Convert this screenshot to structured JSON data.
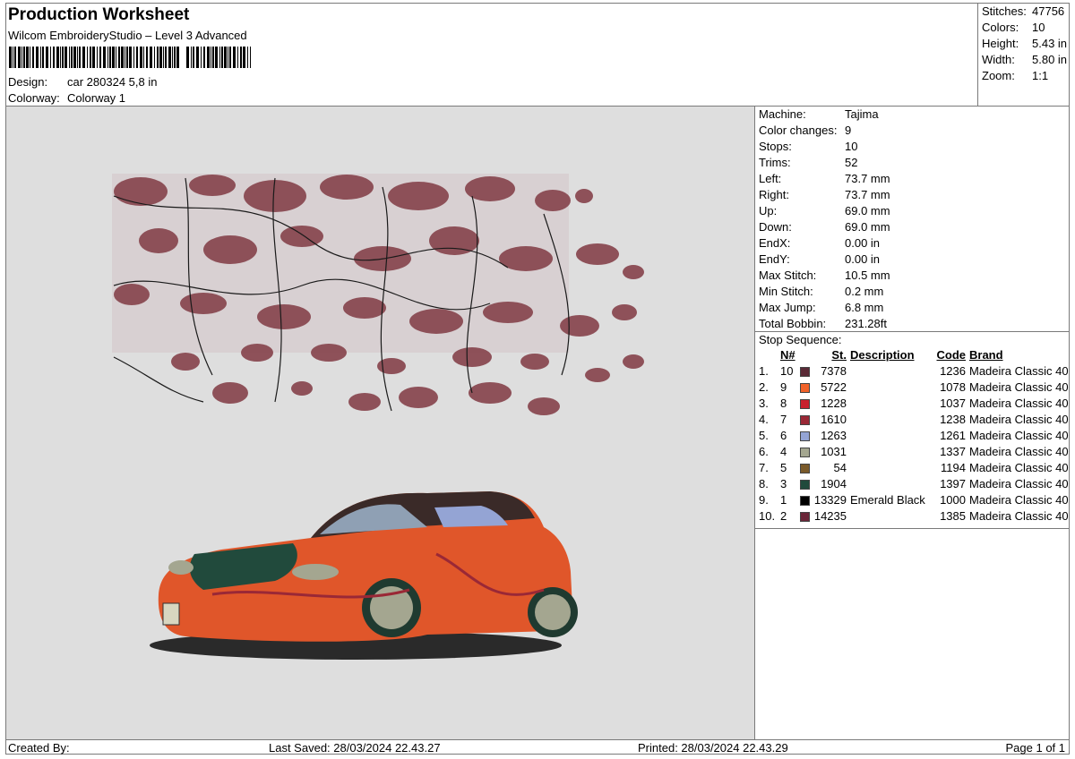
{
  "header": {
    "title": "Production Worksheet",
    "subtitle": "Wilcom EmbroideryStudio – Level 3 Advanced",
    "design_label": "Design:",
    "design_value": "car 280324 5,8 in",
    "colorway_label": "Colorway:",
    "colorway_value": "Colorway 1"
  },
  "summary": [
    {
      "label": "Stitches:",
      "value": "47756"
    },
    {
      "label": "Colors:",
      "value": "10"
    },
    {
      "label": "Height:",
      "value": "5.43 in"
    },
    {
      "label": "Width:",
      "value": "5.80 in"
    },
    {
      "label": "Zoom:",
      "value": "1:1"
    }
  ],
  "machine_info": [
    {
      "label": "Machine:",
      "value": "Tajima"
    },
    {
      "label": "Color changes:",
      "value": "9"
    },
    {
      "label": "Stops:",
      "value": "10"
    },
    {
      "label": "Trims:",
      "value": "52"
    },
    {
      "label": "Left:",
      "value": "73.7 mm"
    },
    {
      "label": "Right:",
      "value": "73.7 mm"
    },
    {
      "label": "Up:",
      "value": "69.0 mm"
    },
    {
      "label": "Down:",
      "value": "69.0 mm"
    },
    {
      "label": "EndX:",
      "value": "0.00 in"
    },
    {
      "label": "EndY:",
      "value": "0.00 in"
    },
    {
      "label": "Max Stitch:",
      "value": "10.5 mm"
    },
    {
      "label": "Min Stitch:",
      "value": "0.2 mm"
    },
    {
      "label": "Max Jump:",
      "value": "6.8 mm"
    },
    {
      "label": "Total Bobbin:",
      "value": "231.28ft"
    }
  ],
  "stop_sequence": {
    "title": "Stop Sequence:",
    "columns": {
      "n": "N#",
      "st": "St.",
      "desc": "Description",
      "code": "Code",
      "brand": "Brand"
    },
    "rows": [
      {
        "idx": "1.",
        "n": "10",
        "color": "#5a2a36",
        "st": "7378",
        "desc": "",
        "code": "1236",
        "brand": "Madeira Classic 40"
      },
      {
        "idx": "2.",
        "n": "9",
        "color": "#f0622a",
        "st": "5722",
        "desc": "",
        "code": "1078",
        "brand": "Madeira Classic 40"
      },
      {
        "idx": "3.",
        "n": "8",
        "color": "#c8202e",
        "st": "1228",
        "desc": "",
        "code": "1037",
        "brand": "Madeira Classic 40"
      },
      {
        "idx": "4.",
        "n": "7",
        "color": "#9a2836",
        "st": "1610",
        "desc": "",
        "code": "1238",
        "brand": "Madeira Classic 40"
      },
      {
        "idx": "5.",
        "n": "6",
        "color": "#94a4d4",
        "st": "1263",
        "desc": "",
        "code": "1261",
        "brand": "Madeira Classic 40"
      },
      {
        "idx": "6.",
        "n": "4",
        "color": "#a4a690",
        "st": "1031",
        "desc": "",
        "code": "1337",
        "brand": "Madeira Classic 40"
      },
      {
        "idx": "7.",
        "n": "5",
        "color": "#7a5a2a",
        "st": "54",
        "desc": "",
        "code": "1194",
        "brand": "Madeira Classic 40"
      },
      {
        "idx": "8.",
        "n": "3",
        "color": "#214a3c",
        "st": "1904",
        "desc": "",
        "code": "1397",
        "brand": "Madeira Classic 40"
      },
      {
        "idx": "9.",
        "n": "1",
        "color": "#000000",
        "st": "13329",
        "desc": "Emerald Black",
        "code": "1000",
        "brand": "Madeira Classic 40"
      },
      {
        "idx": "10.",
        "n": "2",
        "color": "#6a2638",
        "st": "14235",
        "desc": "",
        "code": "1385",
        "brand": "Madeira Classic 40"
      }
    ]
  },
  "footer": {
    "created_by": "Created By:",
    "last_saved": "Last Saved: 28/03/2024 22.43.27",
    "printed": "Printed: 28/03/2024 22.43.29",
    "page": "Page 1 of 1"
  }
}
